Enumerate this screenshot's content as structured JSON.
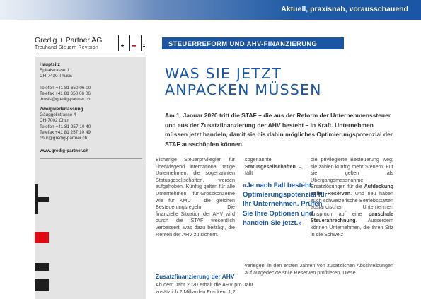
{
  "banner": {
    "tagline": "Aktuell, praxisnah, vorausschauend"
  },
  "logo": {
    "name": "Gredig + Partner AG",
    "sub": "Treuhand  Steuern  Revision"
  },
  "sidebar": {
    "hq": {
      "head": "Hauptsitz",
      "lines": [
        "Spitalstrasse 1",
        "CH-7430 Thusis"
      ],
      "phone": "Telefon  +41 81 650 06 00",
      "fax": "Telefax  +41 81 650 06 06",
      "email": "thusis@gredig-partner.ch"
    },
    "branch": {
      "head": "Zweigniederlassung",
      "lines": [
        "Gäuggelistrasse 4",
        "CH-7002 Chur"
      ],
      "phone": "Telefon  +41 81 257 10 40",
      "fax": "Telefax  +41 81 257 10 49",
      "email": "chur@gredig-partner.ch"
    },
    "website": "www.gredig-partner.ch",
    "colors": {
      "accent_red": "#e30613",
      "dark": "#1e1e1e"
    }
  },
  "article": {
    "section": "STEUERREFORM UND AHV-FINANZIERUNG",
    "title_lines": [
      "WAS SIE JETZT",
      "ANPACKEN MÜSSEN"
    ],
    "lead": "Am 1. Januar 2020 tritt die STAF – die aus der Reform der Unternehmens­steuer und aus der Zusatzfinanzierung der AHV besteht – in Kraft. Unternehmen müssen jetzt handeln, damit sie bis dahin mögliches Optimierungspotenzial der STAF ausschöpfen können.",
    "col1": "Bisherige Steuerprivilegien für überwiegend international tätige Unternehmen, die sogenannten Statusgesellschaften, werden aufgehoben. Künftig gelten für alle Unternehmen – für Grosskonzerne wie für KMU – die gleichen Besteuerungsregeln. Die finanzielle Situation der AHV wird durch die STAF wesentlich verbessert, was dazu beiträgt, die Renten der AHV zu sichern.",
    "col2_pre": "sogenannte ",
    "col2_bold": "Statusgesellschaften",
    "col2_post": " –, fällt",
    "quote": "«Je nach Fall besteht Optimierungspotenzial für Ihr Unternehmen. Prüfen Sie Ihre Optionen und handeln Sie jetzt.»",
    "col3_a": "die privilegierte Besteuerung weg; sie zahlen künftig mehr Steuern. Für sie gelten als Übergangsmassnahme Ersatzlösungen für die ",
    "col3_b": "Aufdeckung stiller Reserven",
    "col3_c": ". Und neu haben auch schweizerische Betriebsstätten ausländischer Unternehmen Anspruch auf eine ",
    "col3_d": "pauschale Steueranrechnung",
    "col3_e": ". Ausserdem können Unternehmen, die ihren Sitz in die Schweiz",
    "col2_after": "verlegen, in den ersten Jahren von zusätzlichen Abschreibungen auf aufgedeckte stille Reserven profitieren. Diese",
    "subhead": "Zusatzfinanzierung der AHV",
    "col1_after": "Ab dem Jahr 2020 erhält die AHV pro Jahr zusätzlich 2 Milliarden Franken. 1,2"
  }
}
